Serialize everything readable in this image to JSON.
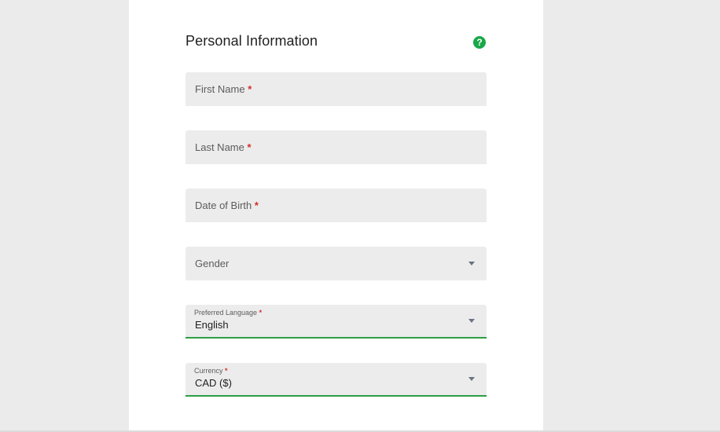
{
  "form": {
    "title": "Personal Information",
    "help_icon": "question-circle-icon",
    "required_mark": "*",
    "fields": {
      "first_name": {
        "label": "First Name",
        "required": true
      },
      "last_name": {
        "label": "Last Name",
        "required": true
      },
      "date_of_birth": {
        "label": "Date of Birth",
        "required": true
      },
      "gender": {
        "label": "Gender",
        "value": ""
      },
      "preferred_language": {
        "label": "Preferred Language",
        "value": "English",
        "required": true
      },
      "currency": {
        "label": "Currency",
        "value": "CAD ($)",
        "required": true
      }
    }
  },
  "colors": {
    "accent": "#2e9e45",
    "help_icon": "#1aa84a",
    "required": "#d32f2f",
    "field_bg": "#ececec",
    "page_bg": "#ebebeb"
  }
}
